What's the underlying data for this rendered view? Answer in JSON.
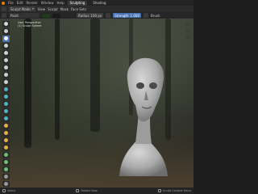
{
  "topbar": {
    "menus": [
      "File",
      "Edit",
      "Render",
      "Window",
      "Help"
    ],
    "workspaces": [
      "Sculpting",
      "Shading"
    ],
    "active_workspace": "Sculpting"
  },
  "header": {
    "mode": "Sculpt Mode",
    "menus": [
      "View",
      "Sculpt",
      "Mask",
      "Face Sets"
    ]
  },
  "tool_header": {
    "brush_name": "Paint",
    "radius_label": "Radius",
    "radius_value": "100 px",
    "strength_label": "Strength",
    "strength_value": "1.000",
    "brush_label": "Brush",
    "color_swatch": "#1e3a1e",
    "secondary_swatch": "#1a1a1a"
  },
  "viewport": {
    "info_lines": [
      "User Perspective",
      "(1) Sculpt Sphere"
    ]
  },
  "toolbar": {
    "tools": [
      {
        "name": "draw-tool",
        "color": "#d9d9d9",
        "active": false
      },
      {
        "name": "draw-sharp-tool",
        "color": "#cfcfcf",
        "active": false
      },
      {
        "name": "paint-tool",
        "color": "#ffffff",
        "active": true
      },
      {
        "name": "clay-tool",
        "color": "#cfcfcf",
        "active": false
      },
      {
        "name": "clay-strips-tool",
        "color": "#cfcfcf",
        "active": false
      },
      {
        "name": "layer-tool",
        "color": "#cfcfcf",
        "active": false
      },
      {
        "name": "inflate-tool",
        "color": "#cfcfcf",
        "active": false
      },
      {
        "name": "blob-tool",
        "color": "#cfcfcf",
        "active": false
      },
      {
        "name": "crease-tool",
        "color": "#cfcfcf",
        "active": false
      },
      {
        "name": "smooth-tool",
        "color": "#4fb3c4",
        "active": false
      },
      {
        "name": "flatten-tool",
        "color": "#4fb3c4",
        "active": false
      },
      {
        "name": "fill-tool",
        "color": "#4fb3c4",
        "active": false
      },
      {
        "name": "scrape-tool",
        "color": "#4fb3c4",
        "active": false
      },
      {
        "name": "multiplane-scrape-tool",
        "color": "#4fb3c4",
        "active": false
      },
      {
        "name": "pinch-tool",
        "color": "#e0b040",
        "active": false
      },
      {
        "name": "grab-tool",
        "color": "#e0b040",
        "active": false
      },
      {
        "name": "elastic-deform-tool",
        "color": "#e0b040",
        "active": false
      },
      {
        "name": "snake-hook-tool",
        "color": "#e0b040",
        "active": false
      },
      {
        "name": "thumb-tool",
        "color": "#6fbf6f",
        "active": false
      },
      {
        "name": "pose-tool",
        "color": "#6fbf6f",
        "active": false
      },
      {
        "name": "nudge-tool",
        "color": "#6fbf6f",
        "active": false
      },
      {
        "name": "mask-tool",
        "color": "#9a9a9a",
        "active": false
      },
      {
        "name": "box-mask-tool",
        "color": "#9a9a9a",
        "active": false
      },
      {
        "name": "transform-tool",
        "color": "#9a9a9a",
        "active": false
      },
      {
        "name": "annotate-tool",
        "color": "#9a9a9a",
        "active": false
      }
    ]
  },
  "statusbar": {
    "left": "Select",
    "middle": "Rotate View",
    "right": "Sculpt Context Menu"
  }
}
